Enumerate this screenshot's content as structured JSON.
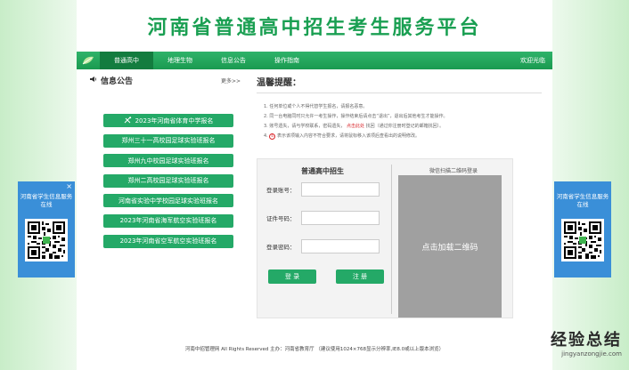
{
  "header": {
    "title": "河南省普通高中招生考生服务平台"
  },
  "nav": {
    "items": [
      "普通高中",
      "地理生物",
      "信息公告",
      "操作指南"
    ],
    "welcome": "欢迎光临"
  },
  "notice": {
    "title": "信息公告",
    "more": "更多>>"
  },
  "announcements": [
    "2023年河南省体育中学报名",
    "郑州三十一高校园足球实验班报名",
    "郑州九中校园足球实验班报名",
    "郑州二高校园足球实验班报名",
    "河南省实验中学校园足球实验班报名",
    "2023年河南省海军航空实验班报名",
    "2023年河南省空军航空实验班报名"
  ],
  "tips": {
    "title": "温馨提醒：",
    "items": [
      "1. 任何单位或个人不得代替学生报名，请报名恶意。",
      "2. 同一台电脑同时只允许一考生操作，操作结束后请点击“退出”，退出后其他考生才能操作。",
      "3. 账号遗失，请与学校联系，密码遗失，",
      "点击此处",
      "找回（通过你注册时登记的邮箱找回）。",
      "4.",
      "①",
      "表示该项输入内容不符合要求，请将鼠标移入该项后查看出的说明修改。"
    ]
  },
  "login": {
    "title": "普通高中招生",
    "account_label": "登录账号：",
    "id_label": "证件号码：",
    "password_label": "登录密码：",
    "login_button": "登 录",
    "register_button": "注 册"
  },
  "qr_login": {
    "title": "微信扫描二维码登录",
    "placeholder": "点击加载二维码"
  },
  "float_left": {
    "text": "河南省学生信息服务在线",
    "close": "×"
  },
  "float_right": {
    "text": "河南省学生信息服务在线"
  },
  "footer": {
    "text": "河南中招管理网 All Rights Reserved 主办：河南省教育厅 （建议使用1024×768显示分辨率,IE8.0或以上版本浏览）"
  },
  "watermark": {
    "cn": "经验总结",
    "en": "jingyanzongjie.com"
  },
  "colors": {
    "brand_green": "#1a9f52",
    "button_green": "#24a967",
    "float_blue": "#3a8fd8"
  }
}
